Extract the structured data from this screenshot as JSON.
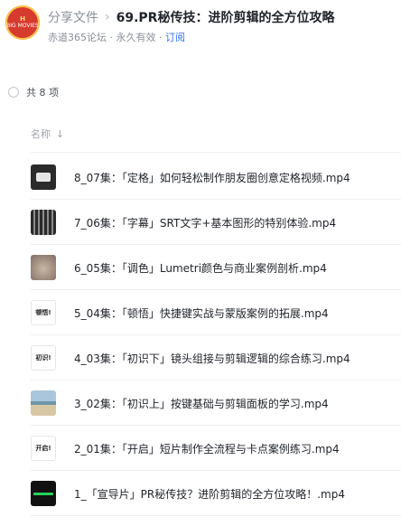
{
  "share": {
    "avatar_text_top": "H",
    "avatar_text_bottom": "BIG MOVIES",
    "breadcrumb_root": "分享文件",
    "breadcrumb_sep": "›",
    "folder_title": "69.PR秘传技：进阶剪辑的全方位攻略",
    "meta_text": "赤道365论坛 · 永久有效 · ",
    "subscribe_link": "订阅"
  },
  "list": {
    "count_text": "共 8 项",
    "col_name": "名称",
    "sort_arrow": "↓",
    "files": [
      {
        "name": "8_07集：「定格」如何轻松制作朋友圈创意定格视频.mp4",
        "thumb": "dark"
      },
      {
        "name": "7_06集：「字幕」SRT文字+基本图形的特别体验.mp4",
        "thumb": "strip"
      },
      {
        "name": "6_05集：「调色」Lumetri颜色与商业案例剖析.mp4",
        "thumb": "cat"
      },
      {
        "name": "5_04集：「顿悟」快捷键实战与蒙版案例的拓展.mp4",
        "thumb": "text",
        "thumb_text": "顿悟!"
      },
      {
        "name": "4_03集：「初识下」镜头组接与剪辑逻辑的综合练习.mp4",
        "thumb": "text",
        "thumb_text": "初识!"
      },
      {
        "name": "3_02集：「初识上」按键基础与剪辑面板的学习.mp4",
        "thumb": "beach"
      },
      {
        "name": "2_01集：「开启」短片制作全流程与卡点案例练习.mp4",
        "thumb": "text",
        "thumb_text": "开启!"
      },
      {
        "name": "1_「宣导片」PR秘传技？进阶剪辑的全方位攻略！.mp4",
        "thumb": "green"
      }
    ]
  }
}
